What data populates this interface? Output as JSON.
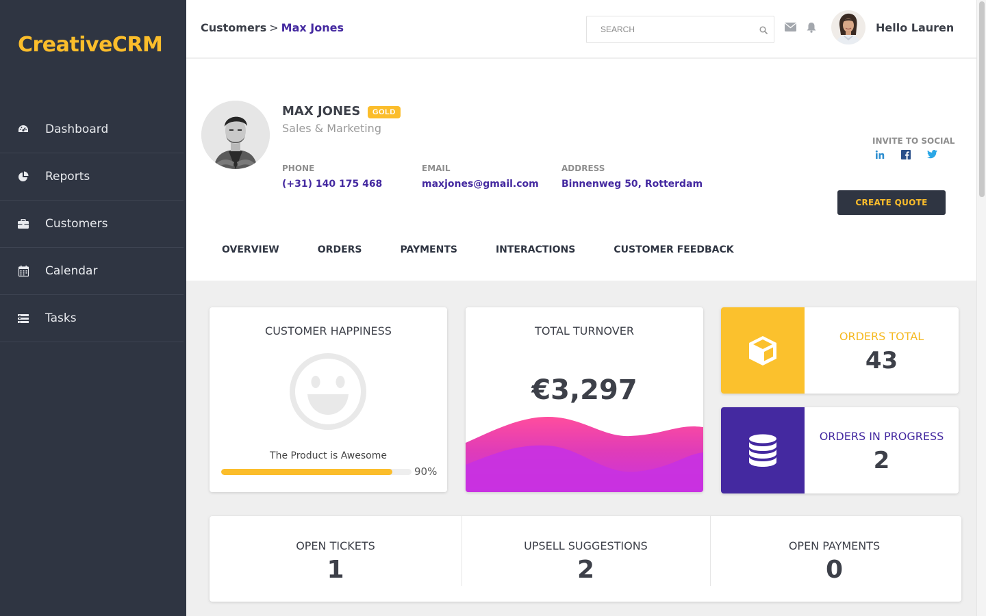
{
  "app": {
    "brand": "CreativeCRM"
  },
  "sidebar": {
    "items": [
      {
        "label": "Dashboard",
        "icon": "dashboard-gauge-icon"
      },
      {
        "label": "Reports",
        "icon": "pie-chart-icon"
      },
      {
        "label": "Customers",
        "icon": "briefcase-icon"
      },
      {
        "label": "Calendar",
        "icon": "calendar-icon"
      },
      {
        "label": "Tasks",
        "icon": "list-icon"
      }
    ]
  },
  "header": {
    "breadcrumb": {
      "parent": "Customers",
      "separator": ">",
      "current": "Max Jones"
    },
    "search": {
      "placeholder": "SEARCH",
      "value": ""
    },
    "greeting": "Hello Lauren"
  },
  "profile": {
    "name": "MAX JONES",
    "tier": "GOLD",
    "role": "Sales & Marketing",
    "phone": {
      "label": "PHONE",
      "value": "(+31) 140 175 468"
    },
    "email": {
      "label": "EMAIL",
      "value": "maxjones@gmail.com"
    },
    "address": {
      "label": "ADDRESS",
      "value": "Binnenweg 50, Rotterdam"
    },
    "invite_label": "INVITE TO SOCIAL",
    "social": [
      "linkedin-icon",
      "facebook-icon",
      "twitter-icon"
    ],
    "create_quote_label": "CREATE QUOTE"
  },
  "tabs": [
    "OVERVIEW",
    "ORDERS",
    "PAYMENTS",
    "INTERACTIONS",
    "CUSTOMER FEEDBACK"
  ],
  "cards": {
    "happiness": {
      "title": "CUSTOMER HAPPINESS",
      "caption": "The Product is Awesome",
      "percent": 90,
      "percent_label": "90%"
    },
    "turnover": {
      "title": "TOTAL TURNOVER",
      "value": "€3,297"
    },
    "orders_total": {
      "label": "ORDERS TOTAL",
      "value": "43"
    },
    "orders_in_progress": {
      "label": "ORDERS IN PROGRESS",
      "value": "2"
    }
  },
  "stats": [
    {
      "label": "OPEN TICKETS",
      "value": "1"
    },
    {
      "label": "UPSELL SUGGESTIONS",
      "value": "2"
    },
    {
      "label": "OPEN PAYMENTS",
      "value": "0"
    }
  ],
  "colors": {
    "accent": "#fbbd2b",
    "primary": "#4429a0",
    "sidebar": "#2f3542",
    "wave_top": "#ff4d9d",
    "wave_bottom": "#c832e0"
  }
}
